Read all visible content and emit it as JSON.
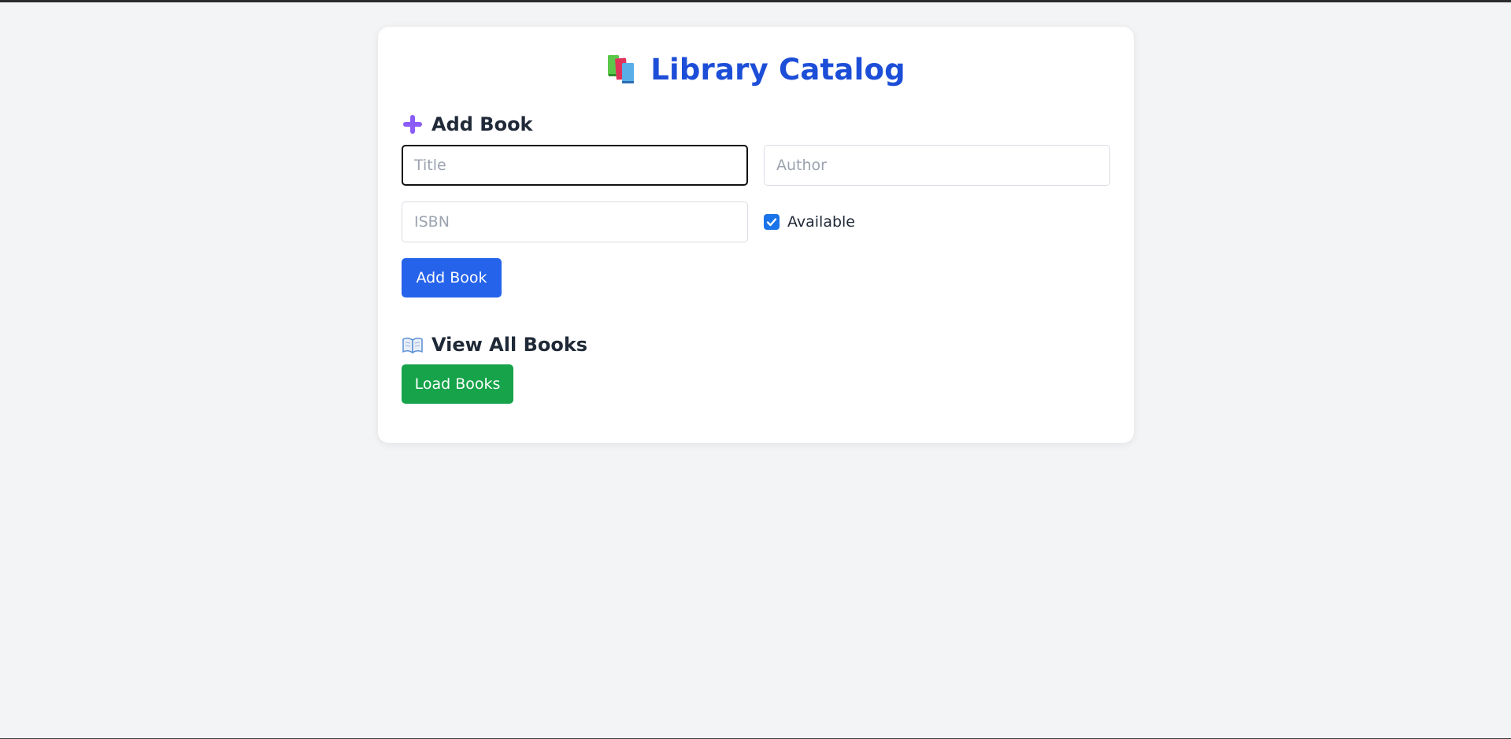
{
  "app": {
    "title": "Library Catalog",
    "title_icon": "books-icon"
  },
  "add_section": {
    "heading": "Add Book",
    "icon": "plus-icon",
    "title_placeholder": "Title",
    "author_placeholder": "Author",
    "isbn_placeholder": "ISBN",
    "title_value": "",
    "author_value": "",
    "isbn_value": "",
    "available_label": "Available",
    "available_checked": true,
    "submit_label": "Add Book"
  },
  "view_section": {
    "heading": "View All Books",
    "icon": "book-open-icon",
    "load_label": "Load Books"
  },
  "colors": {
    "background": "#f3f4f6",
    "title": "#1d4ed8",
    "add_button": "#2563eb",
    "load_button": "#16a34a",
    "checkbox": "#1a73e8"
  }
}
